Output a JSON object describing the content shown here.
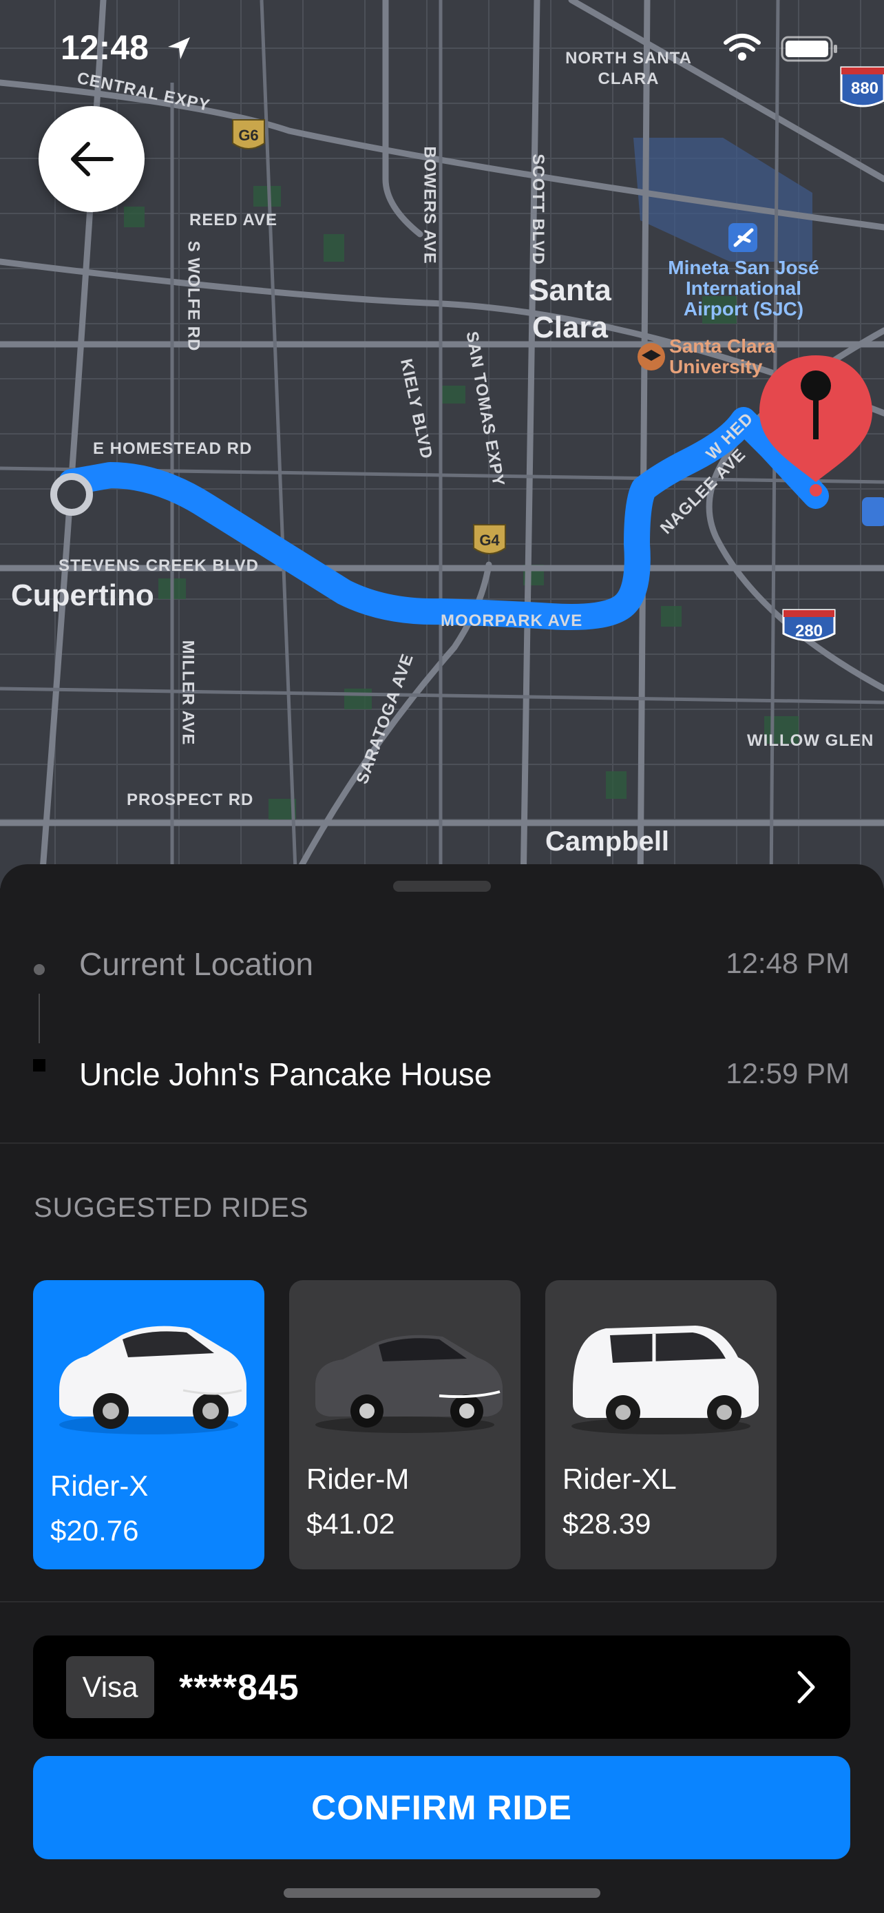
{
  "status_bar": {
    "time": "12:48"
  },
  "map": {
    "labels": {
      "central_expy": "CENTRAL EXPY",
      "reed_ave": "REED AVE",
      "e_homestead_rd": "E HOMESTEAD RD",
      "stevens_creek": "STEVENS CREEK BLVD",
      "cupertino": "Cupertino",
      "santa_clara": "Santa Clara",
      "campbell": "Campbell",
      "moorpark": "MOORPARK AVE",
      "prospect_rd": "PROSPECT RD",
      "miller_ave": "MILLER AVE",
      "saratoga_ave": "SARATOGA AVE",
      "s_wolfe_rd": "S WOLFE RD",
      "bowers_ave": "BOWERS AVE",
      "scott_blvd": "SCOTT BLVD",
      "kiely_blvd": "KIELY BLVD",
      "san_tomas": "SAN TOMAS EXPY",
      "naglee_ave": "NAGLEE AVE",
      "w_hed": "W HED",
      "willow_glen": "WILLOW GLEN",
      "north_santa_clara": "NORTH SANTA CLARA",
      "airport": "Mineta San José International Airport (SJC)",
      "university": "Santa Clara University",
      "g6": "G6",
      "g4": "G4",
      "i280": "280",
      "i880": "880"
    },
    "route_color": "#1a84ff",
    "pin_color": "#e5484d"
  },
  "trip": {
    "origin": {
      "name": "Current Location",
      "time": "12:48 PM"
    },
    "destination": {
      "name": "Uncle John's Pancake House",
      "time": "12:59 PM"
    }
  },
  "suggested": {
    "title": "SUGGESTED RIDES",
    "rides": [
      {
        "name": "Rider-X",
        "price": "$20.76",
        "selected": true
      },
      {
        "name": "Rider-M",
        "price": "$41.02",
        "selected": false
      },
      {
        "name": "Rider-XL",
        "price": "$28.39",
        "selected": false
      }
    ]
  },
  "payment": {
    "brand": "Visa",
    "number": "****845"
  },
  "confirm_label": "CONFIRM RIDE",
  "colors": {
    "accent": "#0a84ff",
    "sheet": "#1c1c1e",
    "card": "#3a3a3c"
  }
}
